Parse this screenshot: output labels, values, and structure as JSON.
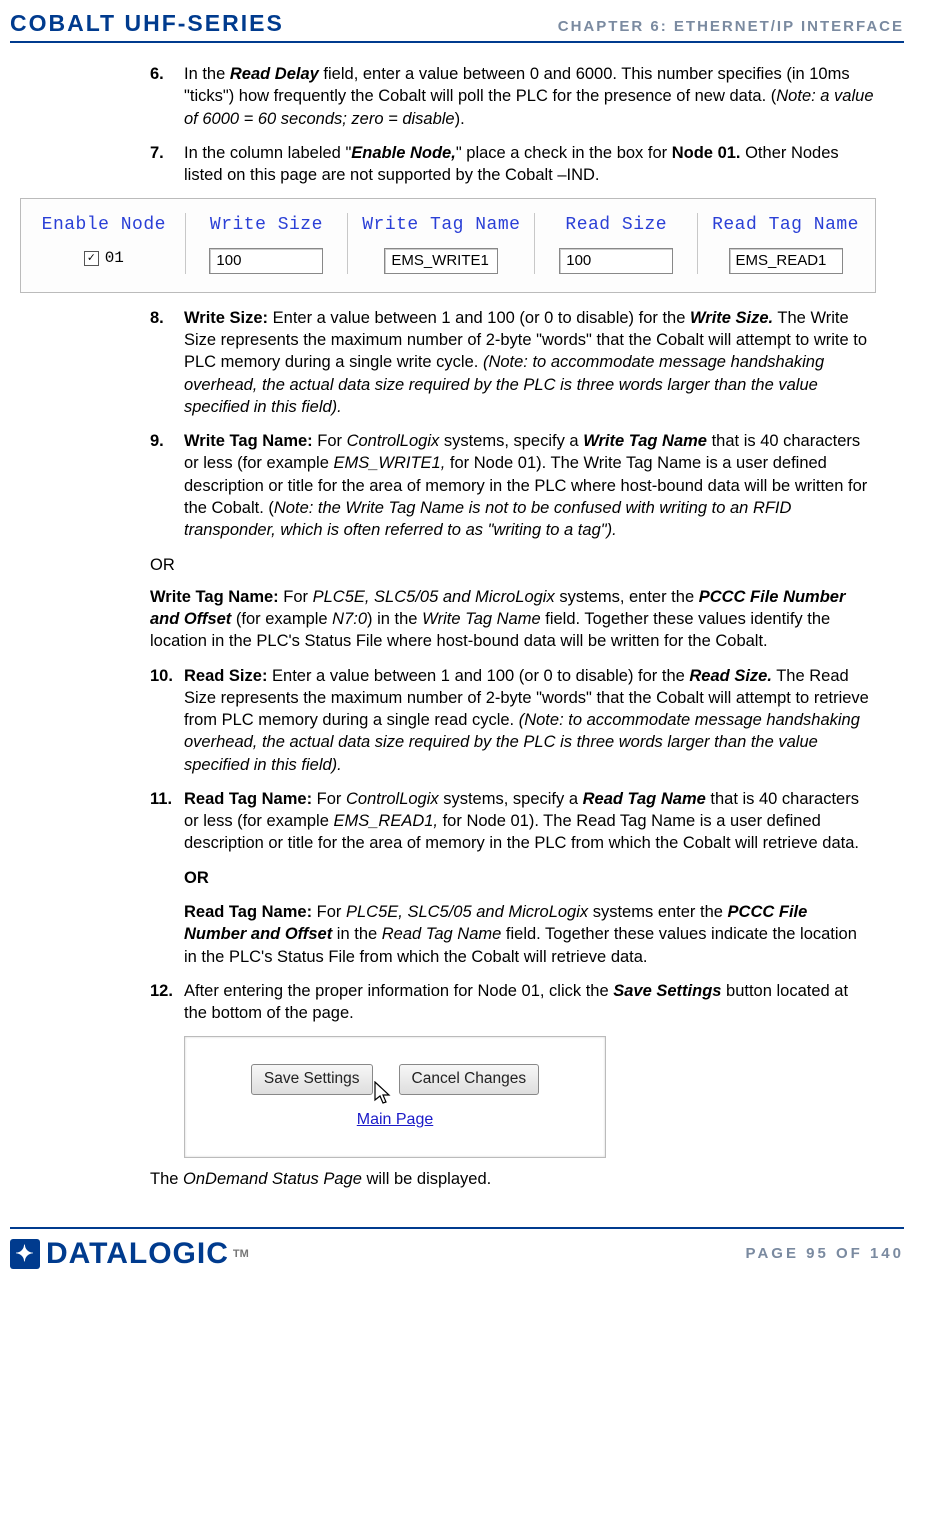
{
  "header": {
    "series": "COBALT UHF-SERIES",
    "chapter": "CHAPTER 6: ETHERNET/IP INTERFACE"
  },
  "steps": {
    "s6": {
      "num": "6.",
      "text_pre": "In the ",
      "field": "Read Delay",
      "text_mid": " field, enter a value between 0 and 6000. This number specifies (in 10ms \"ticks\") how frequently the Cobalt will poll the PLC for the presence of new data. (",
      "note": "Note: a value of 6000 = 60 seconds; zero = disable",
      "text_post": ")."
    },
    "s7": {
      "num": "7.",
      "text_pre": "In the column labeled \"",
      "field": "Enable Node,",
      "text_mid": "\" place a check in the box for ",
      "node": "Node 01.",
      "text_post": " Other Nodes listed on this page are not supported by the Cobalt –IND."
    },
    "s8": {
      "num": "8.",
      "label": "Write Size: ",
      "lead": "Enter a value between 1 and 100 (or 0 to disable) for the ",
      "field": "Write Size.",
      "body": " The Write Size represents the maximum number of 2-byte \"words\" that the Cobalt will attempt to write to PLC memory during a single write cycle. ",
      "note": "(Note: to accommodate message handshaking overhead, the actual data size required by the PLC is three words larger than the value specified in this field)."
    },
    "s9": {
      "num": "9.",
      "label": "Write Tag Name: ",
      "lead": "For ",
      "sys": "ControlLogix",
      "mid": " systems, specify a ",
      "field": "Write Tag Name",
      "mid2": " that is 40 characters or less (for example ",
      "ex": "EMS_WRITE1,",
      "mid3": " for Node 01). The Write Tag Name is a user defined description or title for the area of memory in the PLC where host-bound data will be written for the Cobalt. (",
      "note": "Note: the Write Tag Name is not to be confused with writing to an RFID transponder, which is often referred to as \"writing to a tag\").",
      "or": "OR",
      "alt_label": "Write Tag Name: ",
      "alt_lead": "For ",
      "alt_sys": "PLC5E, SLC5/05 and MicroLogix",
      "alt_mid": " systems, enter the ",
      "alt_field": "PCCC File Number and Offset",
      "alt_mid2": " (for example ",
      "alt_ex": "N7:0",
      "alt_mid3": ") in the ",
      "alt_field2": "Write Tag Name",
      "alt_post": " field. Together these values identify the location in the PLC's Status File where host-bound data will be written for the Cobalt."
    },
    "s10": {
      "num": "10.",
      "label": "Read Size: ",
      "lead": "Enter a value between 1 and 100 (or 0 to disable) for the ",
      "field": "Read Size.",
      "body": " The Read Size represents the maximum number of 2-byte \"words\" that the Cobalt will attempt to retrieve from PLC memory during a single read cycle. ",
      "note": "(Note: to accommodate message handshaking overhead, the actual data size required by the PLC is three words larger than the value specified in this field)."
    },
    "s11": {
      "num": "11.",
      "label": "Read Tag Name: ",
      "lead": "For ",
      "sys": "ControlLogix",
      "mid": " systems, specify a ",
      "field": "Read Tag Name",
      "mid2": " that is 40 characters or less (for example ",
      "ex": "EMS_READ1,",
      "mid3": " for Node 01). The Read Tag Name is a user defined description or title for the area of memory in the PLC from which the Cobalt will retrieve data.",
      "or": "OR",
      "alt_label": "Read Tag Name: ",
      "alt_lead": "For ",
      "alt_sys": "PLC5E, SLC5/05 and MicroLogix",
      "alt_mid": " systems enter the ",
      "alt_field": "PCCC File Number and Offset",
      "alt_mid2": " in the ",
      "alt_field2": "Read Tag Name",
      "alt_post": " field. Together these values indicate the location in the PLC's Status File from which the Cobalt will retrieve data."
    },
    "s12": {
      "num": "12.",
      "lead": "After entering the proper information for Node 01, click the ",
      "field": "Save Settings",
      "post": " button located at the bottom of the page."
    }
  },
  "table": {
    "headers": [
      "Enable Node",
      "Write Size",
      "Write Tag Name",
      "Read Size",
      "Read Tag Name"
    ],
    "row": {
      "node": "01",
      "write_size": "100",
      "write_tag": "EMS_WRITE1",
      "read_size": "100",
      "read_tag": "EMS_READ1"
    }
  },
  "savebox": {
    "save": "Save Settings",
    "cancel": "Cancel Changes",
    "link": "Main Page"
  },
  "closing": {
    "pre": "The ",
    "page": "OnDemand Status Page",
    "post": " will be displayed."
  },
  "footer": {
    "logo": "DATALOGIC",
    "tm": "TM",
    "page": "PAGE 95 OF 140"
  }
}
